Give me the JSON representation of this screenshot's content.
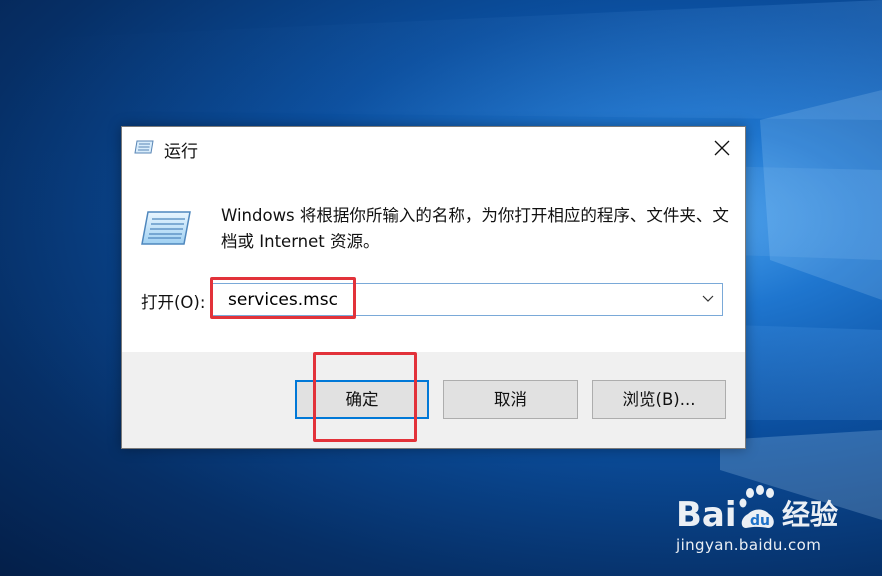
{
  "dialog": {
    "title": "运行",
    "description": "Windows 将根据你所输入的名称，为你打开相应的程序、文件夹、文档或 Internet 资源。",
    "open_label": "打开(O):",
    "command_value": "services.msc",
    "buttons": {
      "ok": "确定",
      "cancel": "取消",
      "browse": "浏览(B)..."
    },
    "icons": {
      "title": "run-icon",
      "main": "run-icon",
      "close": "close-icon",
      "dropdown": "chevron-down-icon"
    }
  },
  "annotations": {
    "highlight_color": "#e2323a"
  },
  "watermark": {
    "logo_text": "Bai 经验",
    "url": "jingyan.baidu.com"
  },
  "colors": {
    "focus_border": "#0078d7",
    "desktop": "#0b4f9f"
  }
}
